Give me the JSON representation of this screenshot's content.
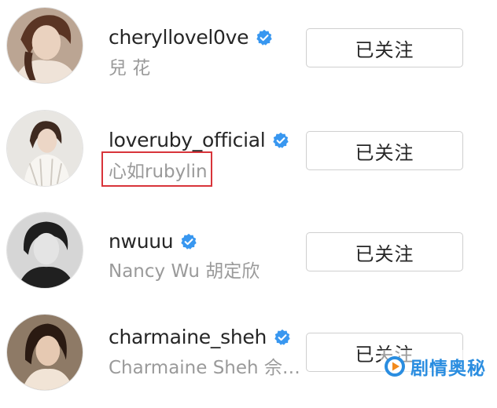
{
  "accounts": [
    {
      "username": "cheryllovel0ve",
      "fullname": "兒 花",
      "button": "已关注",
      "verified_icon": "verified-badge-icon",
      "avatar_icon": "profile-photo"
    },
    {
      "username": "loveruby_official",
      "fullname": "心如rubylin",
      "button": "已关注",
      "verified_icon": "verified-badge-icon",
      "avatar_icon": "profile-photo"
    },
    {
      "username": "nwuuu",
      "fullname": "Nancy Wu  胡定欣",
      "button": "已关注",
      "verified_icon": "verified-badge-icon",
      "avatar_icon": "profile-photo"
    },
    {
      "username": "charmaine_sheh",
      "fullname": "Charmaine Sheh 佘…",
      "button": "已关注",
      "verified_icon": "verified-badge-icon",
      "avatar_icon": "profile-photo"
    }
  ],
  "watermark": {
    "text": "剧情奥秘",
    "icon": "play-logo-icon"
  },
  "colors": {
    "verified": "#3897f0",
    "highlight": "#d8343a",
    "watermark": "#2a8de0",
    "secondary_text": "#9a9a9a"
  }
}
